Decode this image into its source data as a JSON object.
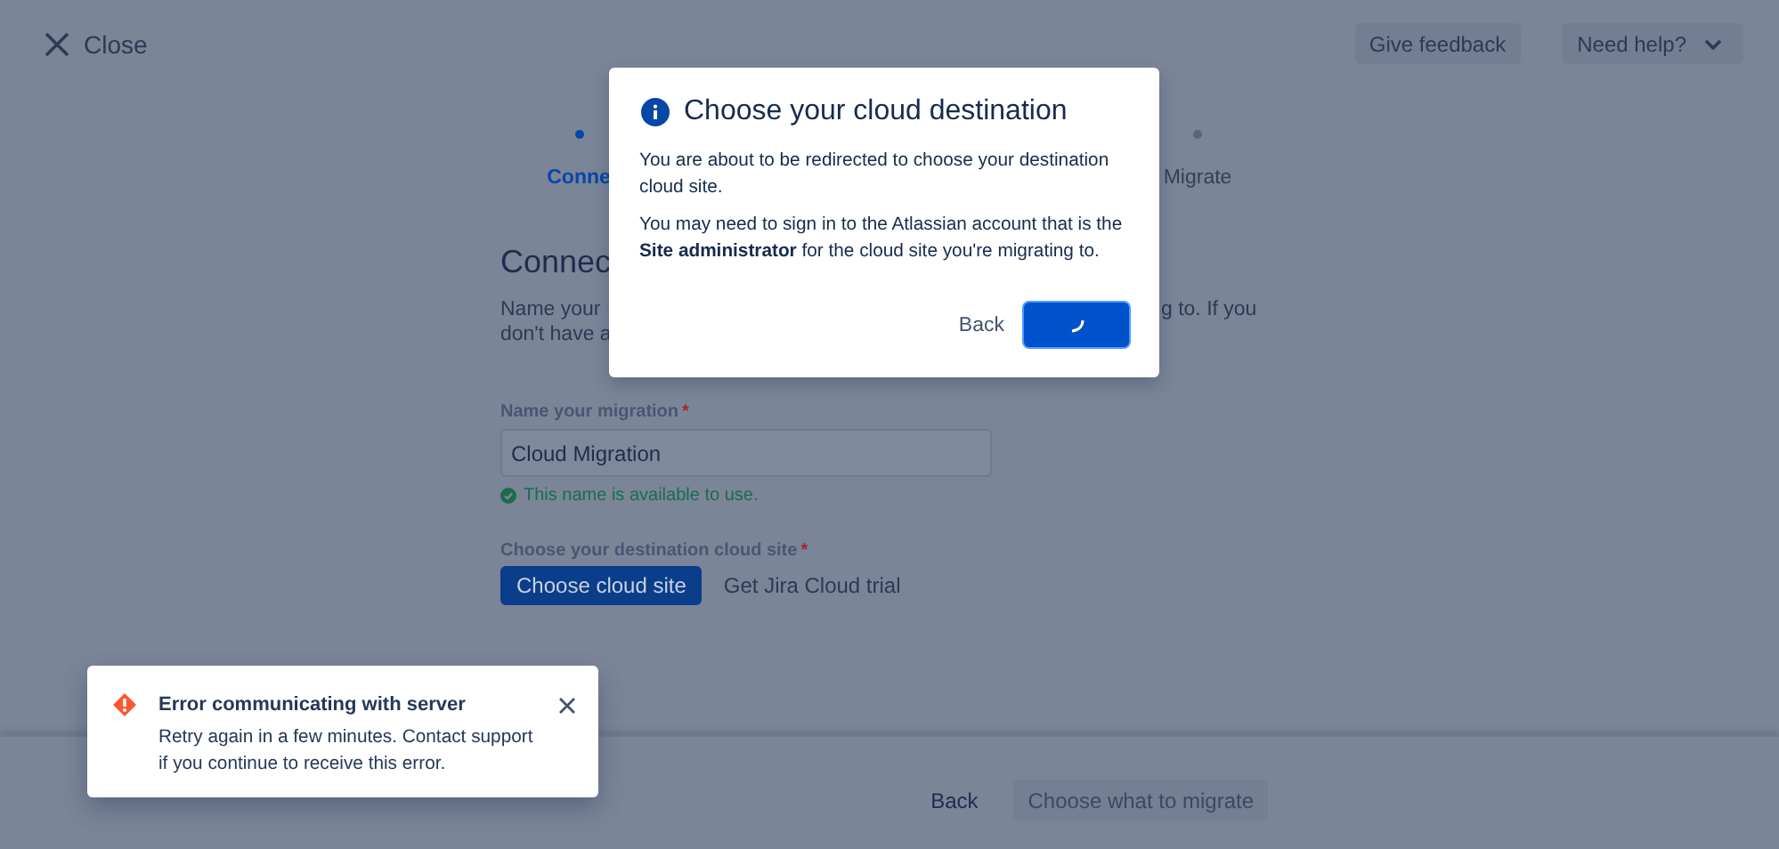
{
  "header": {
    "close": "Close",
    "buttons": [
      {
        "label": "Give feedback",
        "kind": "plain"
      },
      {
        "label": "Need help?",
        "kind": "dropdown"
      }
    ]
  },
  "stepper": {
    "steps": [
      {
        "label": "Conne",
        "selected": true
      },
      {
        "label": "Migrate",
        "selected": false
      }
    ]
  },
  "page": {
    "heading": "Connec",
    "intro_left": [
      "Name your",
      "don't have a"
    ],
    "intro_right": [
      "g to. If you"
    ],
    "name_field": {
      "label": "Name your migration",
      "required_mark": "*",
      "value": "Cloud Migration",
      "message": "This name is available to use."
    },
    "site": {
      "label": "Choose your destination cloud site",
      "required_mark": "*",
      "primary": "Choose cloud site",
      "link": "Get Jira Cloud trial"
    }
  },
  "footer": {
    "buttons": [
      {
        "label": "Back",
        "disabled": false
      },
      {
        "label": "Choose what to migrate",
        "disabled": true
      }
    ]
  },
  "dialog": {
    "title": "Choose your cloud destination",
    "paragraphs": [
      "You are about to be redirected to choose your destination cloud site.",
      "You may need to sign in to the Atlassian account that is the **Site administrator** for the cloud site you're migrating to."
    ],
    "back": "Back",
    "confirm": {
      "loading": true
    }
  },
  "toast": {
    "title": "Error communicating with server",
    "message": "Retry again in a few minutes. Contact support if you continue to receive this error."
  }
}
